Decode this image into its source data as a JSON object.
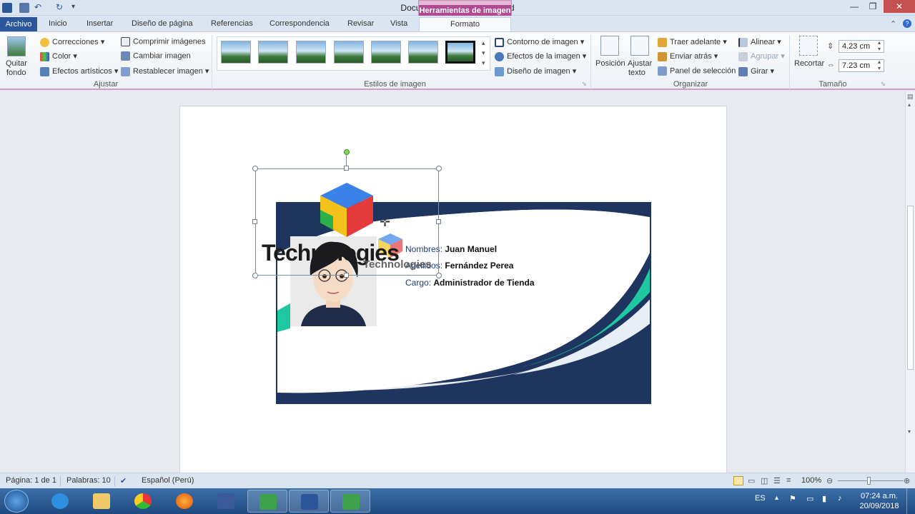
{
  "window": {
    "title": "Documento1 - Microsoft Word",
    "context_tab_group": "Herramientas de imagen"
  },
  "tabs": [
    "Archivo",
    "Inicio",
    "Insertar",
    "Diseño de página",
    "Referencias",
    "Correspondencia",
    "Revisar",
    "Vista",
    "Formato"
  ],
  "ribbon": {
    "ajustar": {
      "quitar_fondo_line1": "Quitar",
      "quitar_fondo_line2": "fondo",
      "correcciones": "Correcciones",
      "color": "Color",
      "efectos_artisticos": "Efectos artísticos",
      "comprimir": "Comprimir imágenes",
      "cambiar": "Cambiar imagen",
      "restablecer": "Restablecer imagen",
      "label": "Ajustar"
    },
    "estilos": {
      "label": "Estilos de imagen",
      "contorno": "Contorno de imagen",
      "efectos": "Efectos de la imagen",
      "diseno": "Diseño de imagen"
    },
    "organizar": {
      "posicion": "Posición",
      "ajustar_texto_line1": "Ajustar",
      "ajustar_texto_line2": "texto",
      "traer_adelante": "Traer adelante",
      "enviar_atras": "Enviar atrás",
      "panel_seleccion": "Panel de selección",
      "alinear": "Alinear",
      "agrupar": "Agrupar",
      "girar": "Girar",
      "label": "Organizar"
    },
    "tamano": {
      "recortar": "Recortar",
      "alto": "4.23 cm",
      "ancho": "7.23 cm",
      "label": "Tamaño"
    }
  },
  "card": {
    "nombres_label": "Nombres:",
    "nombres_value": "Juan Manuel",
    "apellidos_label": "Apellidos:",
    "apellidos_value": "Fernández Perea",
    "cargo_label": "Cargo:",
    "cargo_value": "Administrador de Tienda",
    "logo_text": "Technologies"
  },
  "status": {
    "pagina": "Página: 1 de 1",
    "palabras": "Palabras: 10",
    "idioma": "Español (Perú)",
    "zoom": "100%"
  },
  "taskbar": {
    "lang": "ES",
    "time": "07:24 a.m.",
    "date": "20/09/2018"
  },
  "colors": {
    "accent": "#2b579a",
    "card_navy": "#1e3560",
    "card_teal": "#1ec8a0"
  }
}
